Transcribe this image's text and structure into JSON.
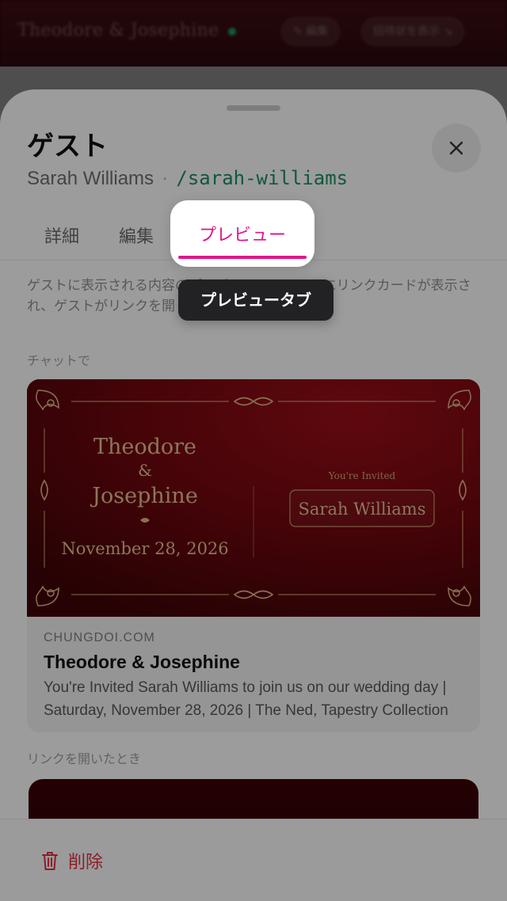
{
  "background": {
    "couple_title": "Theodore & Josephine",
    "edit_label": "✎ 編集",
    "invite_label": "招待状を表示 ↘"
  },
  "sheet": {
    "title": "ゲスト",
    "guest_name": "Sarah Williams",
    "separator": "·",
    "slug": "/sarah-williams"
  },
  "tabs": [
    {
      "label": "詳細"
    },
    {
      "label": "編集"
    },
    {
      "label": "プレビュー",
      "active": true
    }
  ],
  "tooltip": "プレビュータブ",
  "description": "ゲストに表示される内容のプレビュー。チャットにリンクカードが表示され、ゲストがリンクを開くと封筒が表示されます。",
  "chat_section": {
    "label": "チャットで",
    "invitation": {
      "names_line1": "Theodore",
      "ampersand": "&",
      "names_line2": "Josephine",
      "date": "November 28, 2026",
      "youre_invited": "You're Invited",
      "guest_name": "Sarah Williams"
    },
    "domain": "CHUNGDOI.COM",
    "card_title": "Theodore & Josephine",
    "card_description": "You're Invited Sarah Williams to join us on our wedding day | Saturday, November 28, 2026 | The Ned, Tapestry Collection"
  },
  "open_section": {
    "label": "リンクを開いたとき"
  },
  "footer": {
    "delete_label": "削除"
  },
  "colors": {
    "accent": "#e0158a",
    "slug": "#1a8a5e",
    "danger": "#d9303e",
    "invite_bg": "#6c070d",
    "gold": "#d8b184"
  },
  "icons": [
    "close-icon",
    "trash-icon",
    "ornament-icon"
  ]
}
